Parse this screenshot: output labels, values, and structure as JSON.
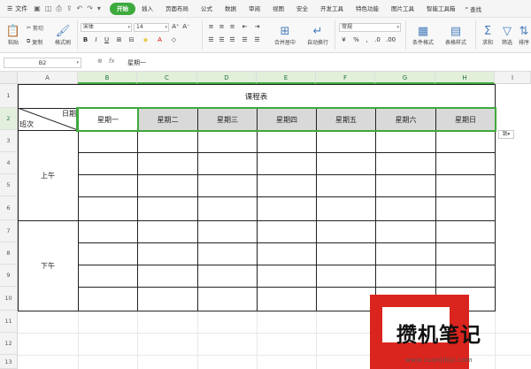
{
  "menubar": {
    "file_label": "文件",
    "tabs": [
      {
        "label": "开始",
        "active": true
      },
      {
        "label": "插入",
        "active": false
      },
      {
        "label": "页面布局",
        "active": false
      },
      {
        "label": "公式",
        "active": false
      },
      {
        "label": "数据",
        "active": false
      },
      {
        "label": "审阅",
        "active": false
      },
      {
        "label": "视图",
        "active": false
      },
      {
        "label": "安全",
        "active": false
      },
      {
        "label": "开发工具",
        "active": false
      },
      {
        "label": "特色功能",
        "active": false
      },
      {
        "label": "图片工具",
        "active": false
      },
      {
        "label": "智能工具箱",
        "active": false
      }
    ],
    "search_label": "查找"
  },
  "ribbon": {
    "paste": "粘贴",
    "cut": "剪切",
    "copy": "复制",
    "format_painter": "格式刷",
    "font_name": "宋体",
    "font_size": "14",
    "merge_center": "合并居中",
    "wrap_text": "自动换行",
    "number_format": "常规",
    "percent_symbol": "%",
    "conditional_format": "条件格式",
    "table_style": "表格样式",
    "sum": "求和",
    "filter": "筛选",
    "sort": "排序"
  },
  "formula_bar": {
    "cell_ref": "B2",
    "fx_label": "fx",
    "value": "星期一"
  },
  "sheet": {
    "columns": [
      "A",
      "B",
      "C",
      "D",
      "E",
      "F",
      "G",
      "H",
      "I"
    ],
    "rows": [
      "1",
      "2",
      "3",
      "4",
      "5",
      "6",
      "7",
      "8",
      "9",
      "10",
      "11",
      "12",
      "13"
    ],
    "title": "课程表",
    "header_date": "日期",
    "header_class": "班次",
    "days": [
      "星期一",
      "星期二",
      "星期三",
      "星期四",
      "星期五",
      "星期六",
      "星期日"
    ],
    "morning": "上午",
    "afternoon": "下午",
    "paste_options": "跳"
  },
  "watermark": {
    "text": "攒机笔记",
    "url": "www.cuanjibiji.com"
  },
  "colors": {
    "accent_green": "#3daa3d",
    "day_header_gray": "#d9d9d9",
    "watermark_red": "#d9251d"
  }
}
